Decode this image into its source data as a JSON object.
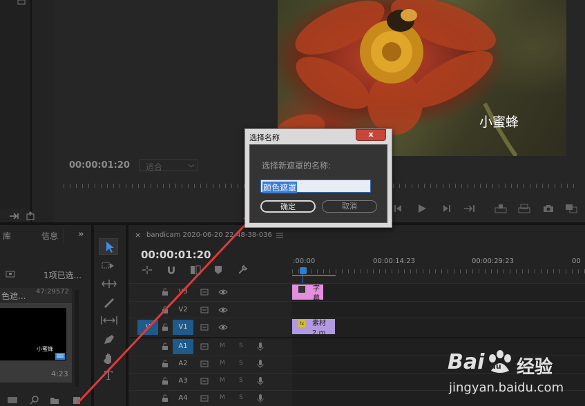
{
  "program_monitor": {
    "timecode": "00:00:01:20",
    "fit_label": "适合",
    "overlay_caption": "小蜜蜂"
  },
  "project_panel": {
    "tab_library": "库",
    "tab_info": "信息",
    "selection_count": "1项已选...",
    "item_name": "色遮...",
    "item_duration_top": "47:29572",
    "thumb_caption": "小蜜蜂",
    "thumb_duration": "4:23"
  },
  "timeline": {
    "sequence_name": "bandicam 2020-06-20 22-48-38-036",
    "timecode": "00:00:01:20",
    "ruler_labels": [
      ":00:00",
      "00:00:14:23",
      "00:00:29:23",
      "00"
    ],
    "tracks": [
      {
        "name": "V3",
        "clip": "字幕"
      },
      {
        "name": "V2",
        "clip": ""
      },
      {
        "name": "V1",
        "clip": "素材2.m"
      },
      {
        "name": "A1",
        "m": "M",
        "s": "S"
      },
      {
        "name": "A2",
        "m": "M",
        "s": "S"
      },
      {
        "name": "A3",
        "m": "M",
        "s": "S"
      },
      {
        "name": "A4",
        "m": "M",
        "s": "S"
      }
    ],
    "source_patch_v": "V",
    "clip_fx": "fx"
  },
  "dialog": {
    "title": "选择名称",
    "prompt": "选择新遮罩的名称:",
    "input_value": "颜色遮罩",
    "ok_label": "确定",
    "cancel_label": "取消",
    "close_glyph": "x"
  },
  "watermark": {
    "brand": "Bai",
    "brand_du": "du",
    "product": "经验",
    "url": "jingyan.baidu.com"
  },
  "colors": {
    "accent_blue": "#2a7fd4",
    "clip_pink": "#e58ee0",
    "clip_purple": "#b39ae0",
    "arrow_red": "#e03a3a",
    "track_active": "#1f5a8a"
  }
}
